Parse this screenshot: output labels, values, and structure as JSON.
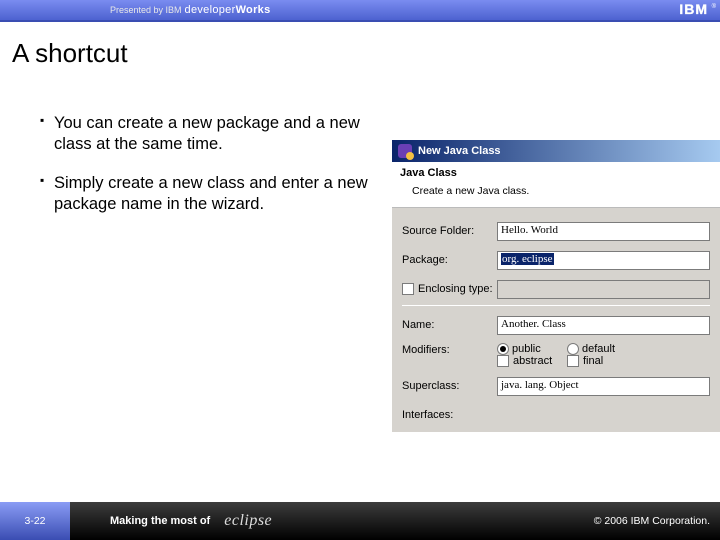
{
  "header": {
    "presented": "Presented by IBM",
    "brand_light": "developer",
    "brand_bold": "Works",
    "logo_text": "IBM",
    "reg": "®"
  },
  "title": "A shortcut",
  "bullets": [
    "You can create a new package and a new class at the same time.",
    "Simply create a new class and enter a new package name in the wizard."
  ],
  "wizard": {
    "titlebar": "New Java Class",
    "banner_title": "Java Class",
    "banner_sub": "Create a new Java class.",
    "labels": {
      "source_folder": "Source Folder:",
      "package": "Package:",
      "enclosing": "Enclosing type:",
      "name": "Name:",
      "modifiers": "Modifiers:",
      "superclass": "Superclass:",
      "interfaces": "Interfaces:"
    },
    "values": {
      "source_folder": "Hello. World",
      "package_sel": "org. eclipse",
      "name": "Another. Class",
      "superclass": "java. lang. Object"
    },
    "modifiers": {
      "public": "public",
      "default": "default",
      "abstract": "abstract",
      "final": "final"
    }
  },
  "footer": {
    "page": "3-22",
    "making": "Making the most of",
    "eclipse": "eclipse",
    "copy": "© 2006 IBM Corporation."
  }
}
